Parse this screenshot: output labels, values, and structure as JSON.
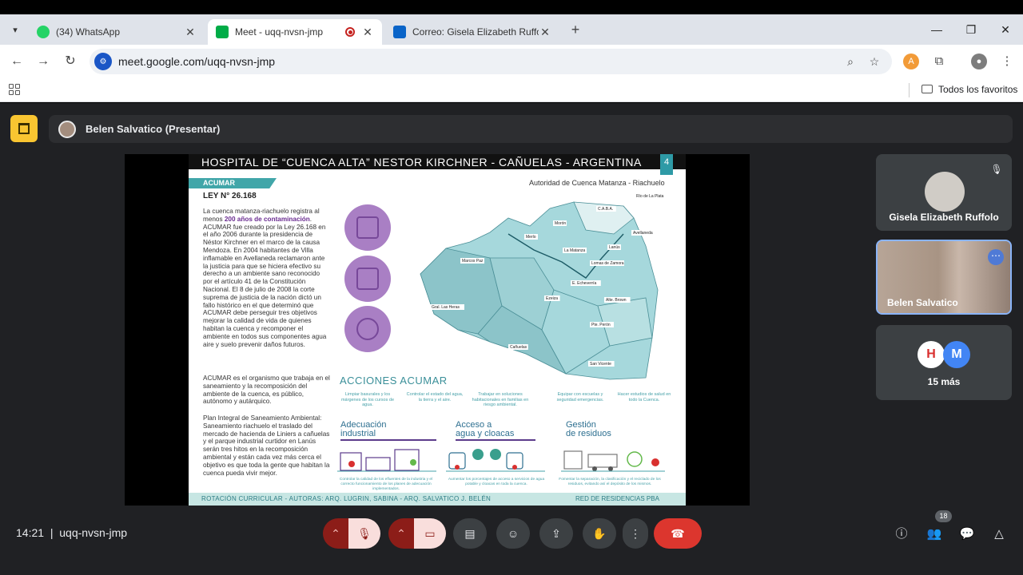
{
  "browser": {
    "tabs": [
      {
        "title": "(34) WhatsApp",
        "favicon_color": "#25d366"
      },
      {
        "title": "Meet - uqq-nvsn-jmp",
        "favicon_color": "#00ac47"
      },
      {
        "title": "Correo: Gisela Elizabeth Ruffolo",
        "favicon_color": "#0a64c8"
      }
    ],
    "url": "meet.google.com/uqq-nvsn-jmp",
    "bookmarks_folder": "Todos los favoritos"
  },
  "meet": {
    "presenter_label": "Belen Salvatico (Presentar)",
    "meeting_code": "uqq-nvsn-jmp",
    "time": "14:21",
    "participants_badge": "18",
    "more_count_label": "15 más",
    "more_avatar_letter": "M",
    "tiles": [
      {
        "name": "Gisela Elizabeth Ruffolo"
      },
      {
        "name": "Belen Salvatico"
      }
    ],
    "accent_red": "#dc362e",
    "accent_yellow": "#f9c531"
  },
  "slide": {
    "title": "HOSPITAL DE “CUENCA ALTA” NESTOR KIRCHNER - CAÑUELAS - ARGENTINA",
    "number": "4",
    "ribbon": "ACUMAR",
    "law": "LEY N° 26.168",
    "authority": "Autoridad de Cuenca Matanza - Riachuelo",
    "para1": "La cuenca matanza-riachuelo registra al menos ",
    "para1_bold": "200 años de contaminación",
    "para1_rest": ". ACUMAR fue creado por la Ley 26.168 en el año 2006 durante la presidencia de Néstor Kirchner en el marco de la causa Mendoza. En 2004 habitantes de Villa inflamable en Avellaneda reclamaron ante la justicia para que se hiciera efectivo su derecho a un ambiente sano reconocido por el artículo 41 de la Constitución Nacional. El 8 de julio de 2008 la corte suprema de justicia de la nación dictó un fallo histórico en el que determinó que ACUMAR debe perseguir tres objetivos mejorar la calidad de vida de quienes habitan la cuenca y recomponer el ambiente en todos sus componentes agua aire y suelo prevenir daños futuros.",
    "para2": "ACUMAR es el organismo que trabaja en el saneamiento y la recomposición del ambiente de la cuenca, es público, autónomo y autárquico.",
    "para3": "Plan Integral de Saneamiento Ambiental: Saneamiento riachuelo el traslado del mercado de hacienda de Liniers a cañuelas y el parque industrial curtidor en Lanús serán tres hitos en la recomposición ambiental y están cada vez más cerca el objetivo es que toda la gente que habitan la cuenca pueda vivir mejor.",
    "actions_title": "ACCIONES ACUMAR",
    "mini_texts": [
      "Limpiar basurales y los márgenes de los cursos de agua.",
      "Controlar el estado del agua, la tierra y el aire.",
      "Trabajar en soluciones habitacionales en familias en riesgo ambiental.",
      "Equipar con escuelas y seguridad emergencias.",
      "Hacer estudios de salud en todo la Cuenca."
    ],
    "sections": [
      {
        "title_1": "Adecuación",
        "title_2": "industrial",
        "caption": "Controlar la calidad de los efluentes de la industria y el correcto funcionamiento de los planes de adecuación implementados."
      },
      {
        "title_1": "Acceso a",
        "title_2": "agua y cloacas",
        "caption": "Aumentar los porcentajes de acceso a servicios de agua potable y cloacas en toda la cuenca."
      },
      {
        "title_1": "Gestión",
        "title_2": "de residuos",
        "caption": "Fomentar la separación, la clasificación y el reciclado de los residuos, evitando así el depósito de los mismos."
      }
    ],
    "map_labels": [
      "C.A.B.A.",
      "Río de La Plata",
      "Morón",
      "Merlo",
      "Avellaneda",
      "Lanús",
      "La Matanza",
      "Marcos Paz",
      "Lomas de Zamora",
      "E. Echeverría",
      "Ezeiza",
      "Alte. Brown",
      "Gral. Las Heras",
      "Pte. Perón",
      "Cañuelas",
      "San Vicente"
    ],
    "footer_left": "ROTACIÓN CURRICULAR - AUTORAS: ARQ. LUGRIN, SABINA - ARQ. SALVATICO J. BELÉN",
    "footer_right": "RED DE RESIDENCIAS PBA"
  }
}
